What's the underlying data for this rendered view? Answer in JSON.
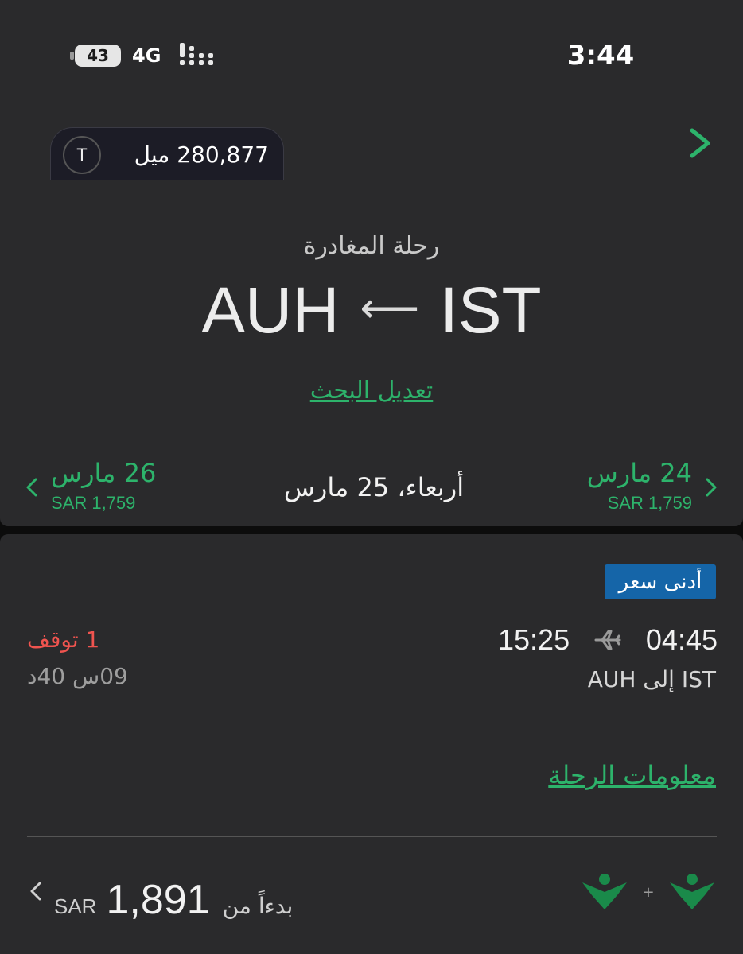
{
  "status_bar": {
    "time": "3:44",
    "battery": "43",
    "network": "4G"
  },
  "header": {
    "avatar_initial": "T",
    "miles": "280,877 ميل"
  },
  "route": {
    "label": "رحلة المغادرة",
    "from": "IST",
    "to": "AUH",
    "arrow": "⟵",
    "edit_link": "تعديل البحث"
  },
  "dates": {
    "prev": {
      "date": "24 مارس",
      "price": "SAR 1,759"
    },
    "current": "أربعاء، 25 مارس",
    "next": {
      "date": "26 مارس",
      "price": "SAR 1,759"
    }
  },
  "flight": {
    "badge": "أدنى سعر",
    "depart_time": "04:45",
    "arrive_time": "15:25",
    "route_text": "IST إلى AUH",
    "stops": "1 توقف",
    "duration": "09س 40د",
    "info_link": "معلومات الرحلة",
    "price_from_label": "بدءاً من",
    "price_value": "1,891",
    "currency": "SAR",
    "plus": "+"
  },
  "colors": {
    "accent_green": "#2db36b",
    "badge_blue": "#1565a8",
    "stop_red": "#f0544f",
    "panel": "#2a2a2c"
  },
  "icons": [
    "battery-icon",
    "signal-icon",
    "chevron-right-icon",
    "chevron-left-icon",
    "left-arrow-icon",
    "plane-icon",
    "airline-logo-icon"
  ]
}
